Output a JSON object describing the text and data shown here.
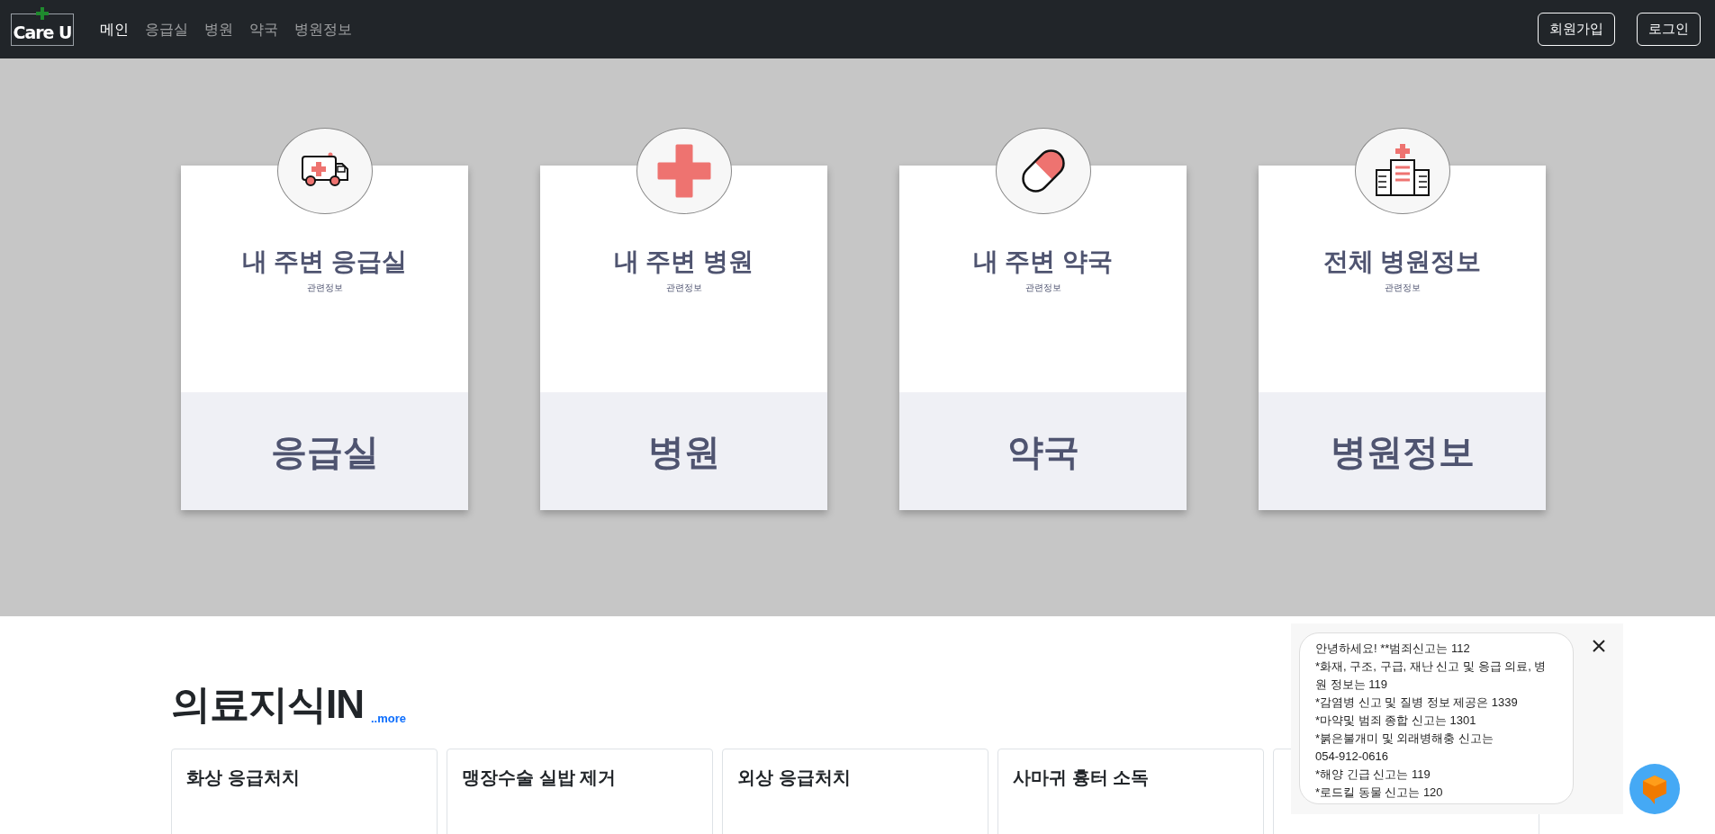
{
  "navbar": {
    "logo": "Care U",
    "links": [
      {
        "label": "메인",
        "selected": true
      },
      {
        "label": "응급실",
        "selected": false
      },
      {
        "label": "병원",
        "selected": false
      },
      {
        "label": "약국",
        "selected": false
      },
      {
        "label": "병원정보",
        "selected": false
      }
    ],
    "buttons": [
      "회원가입",
      "로그인"
    ]
  },
  "services": [
    {
      "kind": "ambulance",
      "title": "내 주변 응급실",
      "subtitle": "관련정보",
      "label": "응급실"
    },
    {
      "kind": "cross",
      "title": "내 주변 병원",
      "subtitle": "관련정보",
      "label": "병원"
    },
    {
      "kind": "pill",
      "title": "내 주변 약국",
      "subtitle": "관련정보",
      "label": "약국"
    },
    {
      "kind": "hospital",
      "title": "전체 병원정보",
      "subtitle": "관련정보",
      "label": "병원정보"
    }
  ],
  "knowledge": {
    "title": "의료지식IN",
    "more": "..more",
    "articles": [
      "화상 응급처치",
      "맹장수술 실밥 제거",
      "외상 응급처치",
      "사마귀 흉터 소독"
    ]
  },
  "chat": {
    "lines": [
      "안녕하세요! **범죄신고는 112",
      "*화재, 구조, 구급, 재난 신고 및 응급 의료, 병원 정보는 119",
      "*감염병 신고 및 질병 정보 제공은 1339",
      "*마약및 범죄 종합 신고는 1301",
      "*붉은불개미 및 외래병해충 신고는",
      "054-912-0616",
      "*해양 긴급 신고는 119",
      "*로드킬 동물 신고는 120"
    ]
  }
}
